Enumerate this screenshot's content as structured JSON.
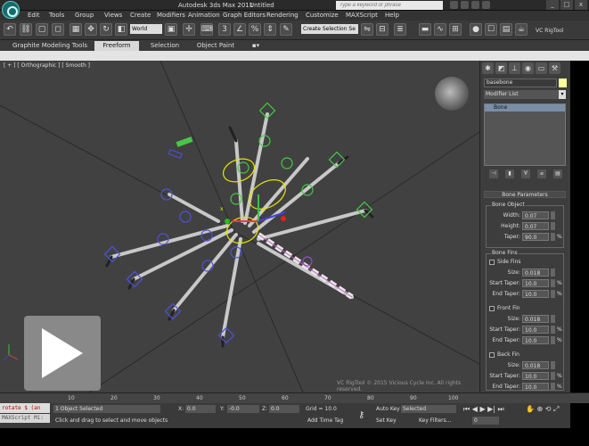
{
  "window": {
    "app_title": "Autodesk 3ds Max 2011",
    "file_title": "Untitled",
    "search_placeholder": "Type a keyword or phrase",
    "minimize": "_",
    "maximize": "□",
    "close": "x"
  },
  "menu": [
    "Edit",
    "Tools",
    "Group",
    "Views",
    "Create",
    "Modifiers",
    "Animation",
    "Graph Editors",
    "Rendering",
    "Customize",
    "MAXScript",
    "Help"
  ],
  "toolbar": {
    "coord_system": "World",
    "selection_set": "Create Selection Se",
    "plugin_label": "VC RigTool"
  },
  "ribbon": {
    "tabs": [
      "Graphite Modeling Tools",
      "Freeform",
      "Selection",
      "Object Paint"
    ],
    "active_tab": "Freeform"
  },
  "viewport": {
    "label": "[ + ] [ Orthographic ] [ Smooth ]",
    "watermark": "VC RigTool © 2015 Vicious Cycle Inc. All rights reserved.",
    "axis_x": "x",
    "axis_y": "y"
  },
  "command_panel": {
    "object_name": "basebone",
    "modifier_list": "Modifier List",
    "stack_item": "Bone",
    "rollout_title": "Bone Parameters",
    "bone_object": {
      "label": "Bone Object",
      "width_label": "Width:",
      "width": "0.07",
      "height_label": "Height:",
      "height": "0.07",
      "taper_label": "Taper:",
      "taper": "90.0"
    },
    "bone_fins": {
      "label": "Bone Fins",
      "side_fins": "Side Fins",
      "front_fin": "Front Fin",
      "back_fin": "Back Fin",
      "size_label": "Size:",
      "start_taper_label": "Start Taper:",
      "end_taper_label": "End Taper:",
      "side": {
        "size": "0.018",
        "start_taper": "10.0",
        "end_taper": "10.0"
      },
      "front": {
        "size": "0.018",
        "start_taper": "10.0",
        "end_taper": "10.0"
      },
      "back": {
        "size": "0.018",
        "start_taper": "10.0",
        "end_taper": "10.0"
      },
      "pct": "%"
    }
  },
  "timeline": {
    "ticks": [
      "10",
      "20",
      "30",
      "40",
      "50",
      "60",
      "70",
      "80",
      "90",
      "100"
    ]
  },
  "status": {
    "maxscript_line1": "rotate $ (an",
    "maxscript_line2": "MAXScript Mi:",
    "selected": "1 Object Selected",
    "prompt": "Click and drag to select and move objects",
    "x_label": "X:",
    "x_value": "0.0",
    "y_label": "Y:",
    "y_value": "-0.0",
    "z_label": "Z:",
    "z_value": "0.0",
    "grid": "Grid = 10.0",
    "add_time_tag": "Add Time Tag",
    "auto_key": "Auto Key",
    "set_key": "Set Key",
    "selected_dropdown": "Selected",
    "key_filters": "Key Filters...",
    "frame": "0"
  },
  "colors": {
    "viewport_bg": "#414141",
    "bone_gray": "#c8c8c8",
    "nub_green": "#46c846",
    "nub_blue": "#5050e0",
    "nub_purple": "#8c50c8",
    "gizmo_yellow": "#e6e600"
  }
}
